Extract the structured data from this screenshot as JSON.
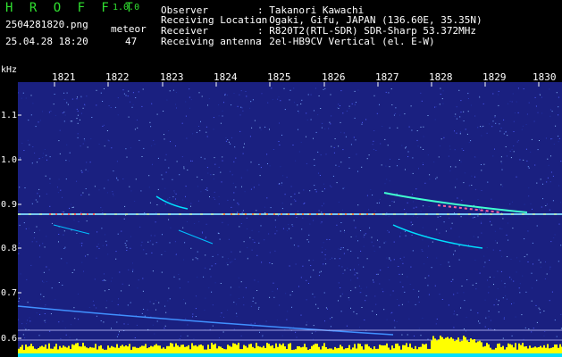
{
  "header": {
    "app_title": "H R O F F T",
    "app_version": "1.0.0",
    "file_name": "2504281820.png",
    "meteor_label": "meteor",
    "meteor_count": "47",
    "date_time": "25.04.28 18:20"
  },
  "info": [
    {
      "label": "Observer",
      "value": ": Takanori Kawachi"
    },
    {
      "label": "Receiving Location",
      "value": ": Ogaki, Gifu, JAPAN (136.60E, 35.35N)"
    },
    {
      "label": "Receiver",
      "value": ": R820T2(RTL-SDR) SDR-Sharp 53.372MHz"
    },
    {
      "label": "Receiving antenna",
      "value": ": 2el-HB9CV Vertical (el. E-W)"
    }
  ],
  "axis": {
    "y_unit": "kHz",
    "x_ticks": [
      "1821",
      "1822",
      "1823",
      "1824",
      "1825",
      "1826",
      "1827",
      "1828",
      "1829",
      "1830"
    ],
    "y_ticks": [
      "1.1",
      "1.0",
      "0.9",
      "0.8",
      "0.7",
      "0.6"
    ]
  },
  "colors": {
    "background": "#1a2080",
    "text_green": "#30e030",
    "signal_yellow": "#ffff00",
    "signal_cyan": "#00e0ff"
  }
}
